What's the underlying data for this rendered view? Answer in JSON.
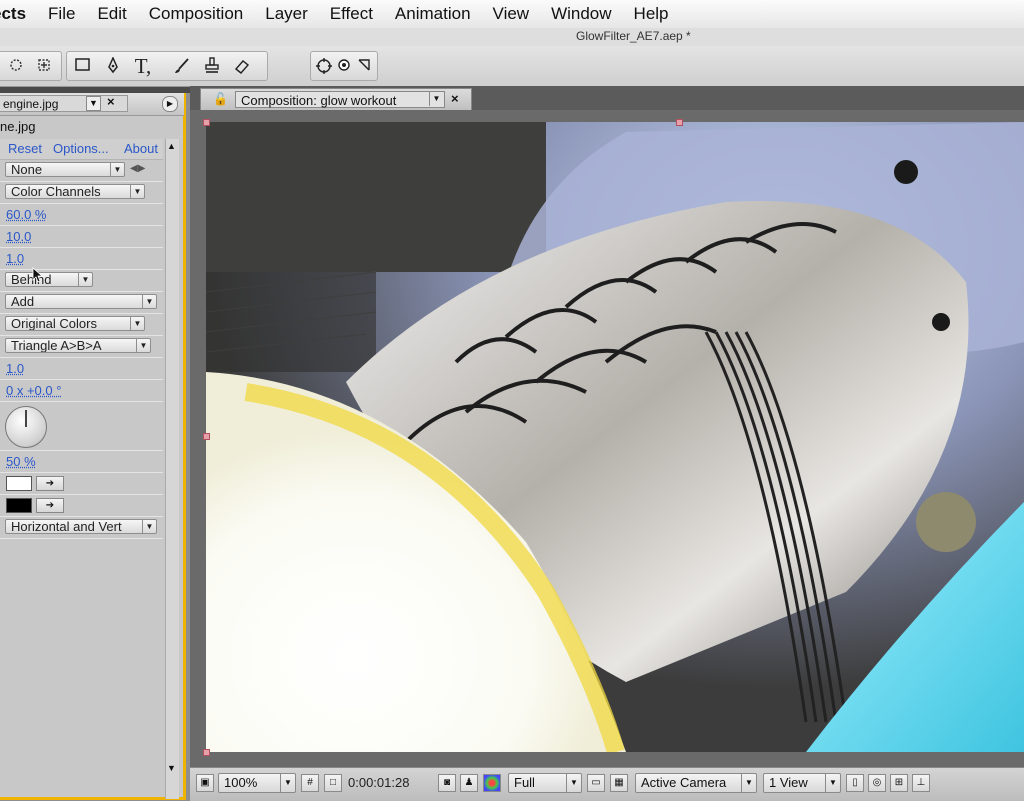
{
  "menubar": {
    "app": "ects",
    "items": [
      "File",
      "Edit",
      "Composition",
      "Layer",
      "Effect",
      "Animation",
      "View",
      "Window",
      "Help"
    ]
  },
  "title": "GlowFilter_AE7.aep *",
  "toolbar": {
    "tools": [
      "pan-behind-icon",
      "hand-icon",
      "rectangle-mask-icon",
      "pen-icon",
      "type-icon",
      "brush-icon",
      "clone-stamp-icon",
      "eraser-icon",
      "orbit-icon",
      "camera-icon",
      "track-icon"
    ],
    "type_glyph": "T,"
  },
  "effect_controls": {
    "tab_label": "engine.jpg",
    "file_label": "ne.jpg",
    "links": {
      "reset": "Reset",
      "options": "Options...",
      "about": "About"
    },
    "glow_based_on": "None",
    "color_channels": "Color Channels",
    "glow_threshold": "60.0 %",
    "glow_radius": "10.0",
    "glow_intensity": "1.0",
    "composite_original": "Behind",
    "glow_operation": "Add",
    "glow_colors": "Original Colors",
    "color_looping": "Triangle A>B>A",
    "color_loops": "1.0",
    "color_phase": "0 x +0.0 °",
    "ab_midpoint": "50 %",
    "color_a": "#ffffff",
    "color_b": "#000000",
    "glow_dimensions": "Horizontal and Vert"
  },
  "composition": {
    "tab_label": "Composition: glow workout",
    "zoom": "100%",
    "timecode": "0:00:01:28",
    "resolution": "Full",
    "camera": "Active Camera",
    "views": "1 View"
  },
  "colors": {
    "panel_highlight": "#f0b400",
    "link_blue": "#2a57c9"
  }
}
